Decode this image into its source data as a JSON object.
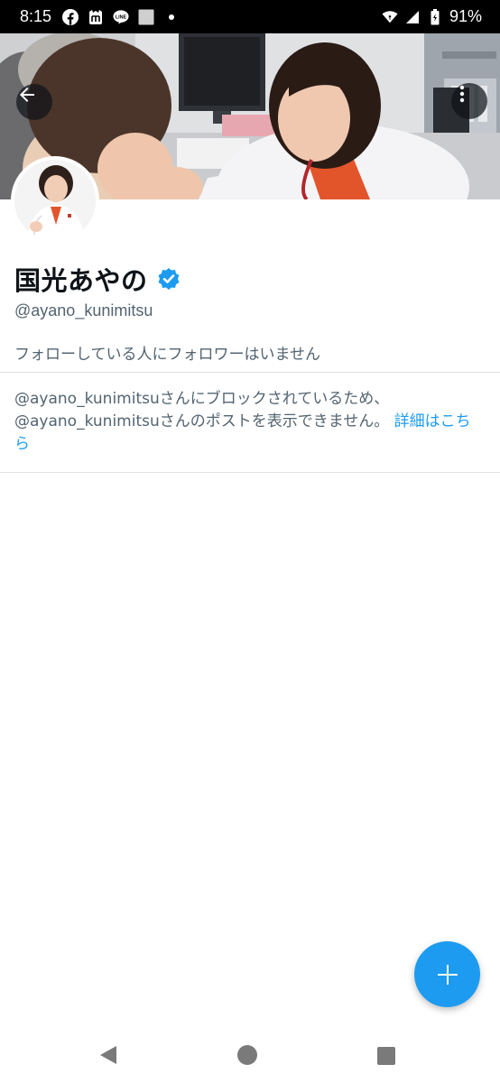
{
  "status_bar": {
    "time": "8:15",
    "battery": "91%",
    "left_icons": [
      "facebook-icon",
      "mi-icon",
      "line-icon",
      "square-notification-icon",
      "dot-icon"
    ],
    "line_label": "LINE",
    "right_icons": [
      "wifi-icon",
      "signal-icon",
      "battery-icon"
    ]
  },
  "profile": {
    "display_name": "国光あやの",
    "handle": "@ayano_kunimitsu",
    "followers_note": "フォローしている人にフォロワーはいません",
    "blocked_message": "@ayano_kunimitsuさんにブロックされているため、@ayano_kunimitsuさんのポストを表示できません。",
    "learn_more": "詳細はこちら"
  },
  "colors": {
    "accent": "#1d9bf0",
    "secondary_text": "#536471",
    "primary_text": "#0f1419"
  }
}
